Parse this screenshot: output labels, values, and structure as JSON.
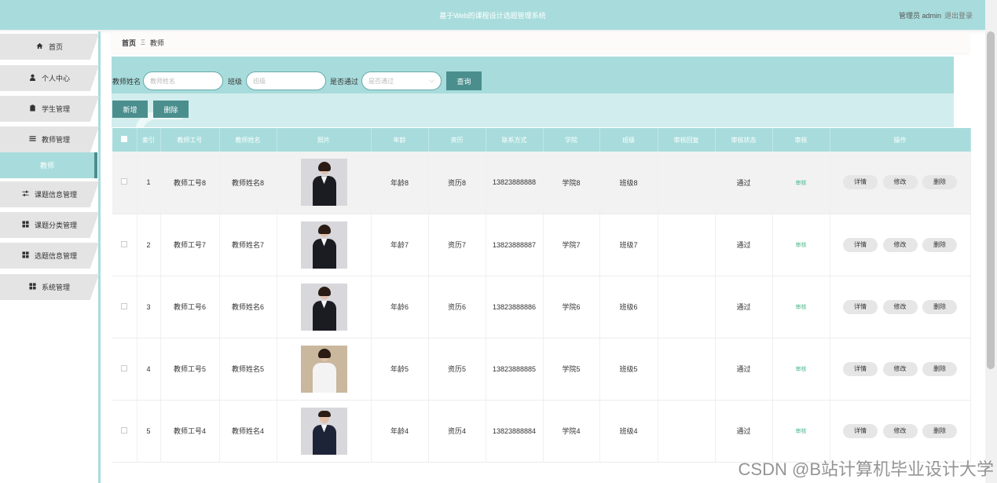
{
  "app": {
    "title": "基于Web的课程设计选题管理系统",
    "user": "管理员 admin",
    "logout": "退出登录"
  },
  "sidebar": {
    "items": [
      {
        "label": "首页",
        "icon": "home-icon"
      },
      {
        "label": "个人中心",
        "icon": "user-icon"
      },
      {
        "label": "学生管理",
        "icon": "clipboard-icon"
      },
      {
        "label": "教师管理",
        "icon": "list-icon"
      },
      {
        "label": "教师",
        "icon": ""
      },
      {
        "label": "课题信息管理",
        "icon": "sliders-icon"
      },
      {
        "label": "课题分类管理",
        "icon": "grid-icon"
      },
      {
        "label": "选题信息管理",
        "icon": "grid-icon"
      },
      {
        "label": "系统管理",
        "icon": "grid-icon"
      }
    ],
    "active_index": 4
  },
  "breadcrumb": {
    "home": "首页",
    "separator": "Ξ",
    "current": "教师"
  },
  "search": {
    "name_label": "教师姓名",
    "name_placeholder": "教师姓名",
    "class_label": "班级",
    "class_placeholder": "班级",
    "pass_label": "是否通过",
    "pass_placeholder": "是否通过",
    "query_button": "查询"
  },
  "toolbar": {
    "add": "新增",
    "delete": "删除"
  },
  "table": {
    "headers": [
      "索引",
      "教师工号",
      "教师姓名",
      "照片",
      "年龄",
      "资历",
      "联系方式",
      "学院",
      "班级",
      "审核回复",
      "审核状态",
      "审核",
      "操作"
    ],
    "rows": [
      {
        "index": "1",
        "id": "教师工号8",
        "name": "教师姓名8",
        "age": "年龄8",
        "qual": "资历8",
        "phone": "13823888888",
        "college": "学院8",
        "class": "班级8",
        "reply": "",
        "status": "通过",
        "audit": "审核"
      },
      {
        "index": "2",
        "id": "教师工号7",
        "name": "教师姓名7",
        "age": "年龄7",
        "qual": "资历7",
        "phone": "13823888887",
        "college": "学院7",
        "class": "班级7",
        "reply": "",
        "status": "通过",
        "audit": "审核"
      },
      {
        "index": "3",
        "id": "教师工号6",
        "name": "教师姓名6",
        "age": "年龄6",
        "qual": "资历6",
        "phone": "13823888886",
        "college": "学院6",
        "class": "班级6",
        "reply": "",
        "status": "通过",
        "audit": "审核"
      },
      {
        "index": "4",
        "id": "教师工号5",
        "name": "教师姓名5",
        "age": "年龄5",
        "qual": "资历5",
        "phone": "13823888885",
        "college": "学院5",
        "class": "班级5",
        "reply": "",
        "status": "通过",
        "audit": "审核"
      },
      {
        "index": "5",
        "id": "教师工号4",
        "name": "教师姓名4",
        "age": "年龄4",
        "qual": "资历4",
        "phone": "13823888884",
        "college": "学院4",
        "class": "班级4",
        "reply": "",
        "status": "通过",
        "audit": "审核"
      }
    ],
    "actions": {
      "detail": "详情",
      "edit": "修改",
      "delete": "删除"
    }
  },
  "watermark": "CSDN @B站计算机毕业设计大学"
}
